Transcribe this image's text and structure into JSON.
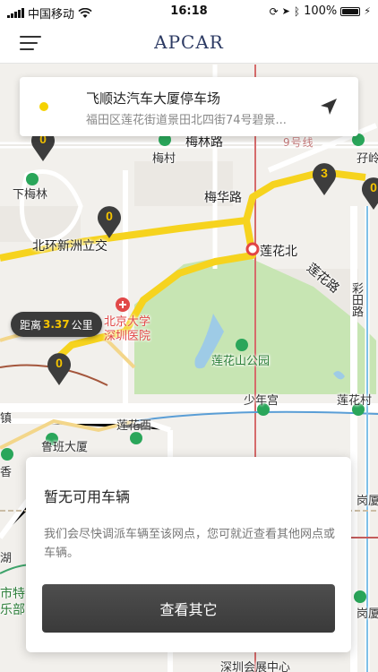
{
  "status_bar": {
    "carrier": "中国移动",
    "time": "16:18",
    "battery": "100%"
  },
  "header": {
    "brand": "APCAR"
  },
  "location_card": {
    "name": "飞顺达汽车大厦停车场",
    "address": "福田区莲花街道景田北四街74号碧景..."
  },
  "map": {
    "labels": {
      "meilin_road": "梅林路",
      "line9": "9号线",
      "meicun": "梅村",
      "xiameilin": "下梅林",
      "meihua_road": "梅华路",
      "beihuan": "北环新洲立交",
      "lianhuabei": "莲花北",
      "lianhua_road": "莲花路",
      "caitian": "彩田路",
      "pku_hospital": "北京大学",
      "hospital2": "深圳医院",
      "park": "莲花山公园",
      "youth_palace": "少年宫",
      "lianhuacun": "莲花村",
      "lianhuaxi": "莲花西",
      "luban": "鲁班大厦",
      "gangling": "岗厦",
      "convention": "深圳会展中心",
      "ziling": "孖岭",
      "gang": "岗厦",
      "hu": "湖",
      "shite": "市特",
      "lebu": "乐部",
      "xiang": "香",
      "zhen": "镇"
    },
    "pins": [
      {
        "count": "0"
      },
      {
        "count": "0"
      },
      {
        "count": "3"
      },
      {
        "count": "0"
      },
      {
        "count": "0"
      }
    ],
    "distance": {
      "prefix": "距离",
      "value": "3.37",
      "unit": "公里"
    }
  },
  "panel": {
    "title": "暂无可用车辆",
    "description": "我们会尽快调派车辆至该网点，您可就近查看其他网点或车辆。",
    "button": "查看其它"
  },
  "colors": {
    "accent": "#F5D200",
    "route": "#F6D31E",
    "brand": "#2C3A63",
    "park": "#C7E5B3"
  },
  "icons": [
    "signal-icon",
    "wifi-icon",
    "menu-icon",
    "navigate-arrow-icon",
    "map-pin-icon",
    "metro-icon",
    "hospital-icon"
  ]
}
